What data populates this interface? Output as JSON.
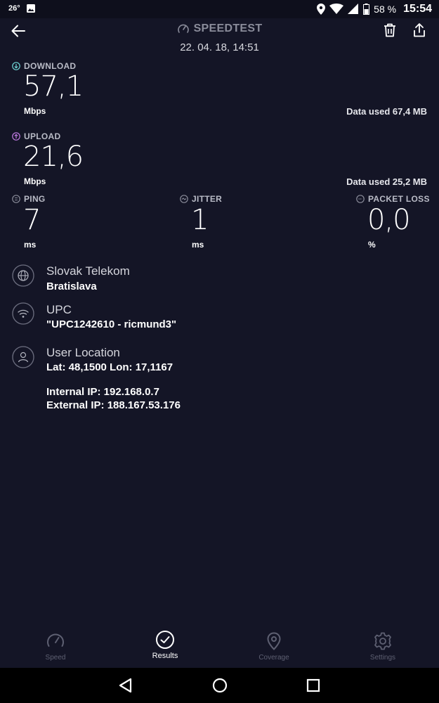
{
  "status_bar": {
    "temperature": "26°",
    "battery_percent": "58 %",
    "time": "15:54"
  },
  "header": {
    "title": "SPEEDTEST",
    "datetime": "22. 04. 18, 14:51"
  },
  "download": {
    "label": "DOWNLOAD",
    "value": "57,1",
    "unit": "Mbps",
    "data_used": "Data used 67,4 MB",
    "icon_color": "#6fd5d6"
  },
  "upload": {
    "label": "UPLOAD",
    "value": "21,6",
    "unit": "Mbps",
    "data_used": "Data used 25,2 MB",
    "icon_color": "#c07be3"
  },
  "ping": {
    "label": "PING",
    "value": "7",
    "unit": "ms"
  },
  "jitter": {
    "label": "JITTER",
    "value": "1",
    "unit": "ms"
  },
  "packet_loss": {
    "label": "PACKET LOSS",
    "value": "0,0",
    "unit": "%"
  },
  "provider": {
    "name": "Slovak Telekom",
    "city": "Bratislava"
  },
  "wifi": {
    "name": "UPC",
    "ssid": "\"UPC1242610 - ricmund3\""
  },
  "location": {
    "title": "User Location",
    "coords": "Lat: 48,1500 Lon: 17,1167",
    "internal_ip": "Internal IP: 192.168.0.7",
    "external_ip": "External IP: 188.167.53.176"
  },
  "bottom_nav": {
    "speed": "Speed",
    "results": "Results",
    "coverage": "Coverage",
    "settings": "Settings"
  }
}
